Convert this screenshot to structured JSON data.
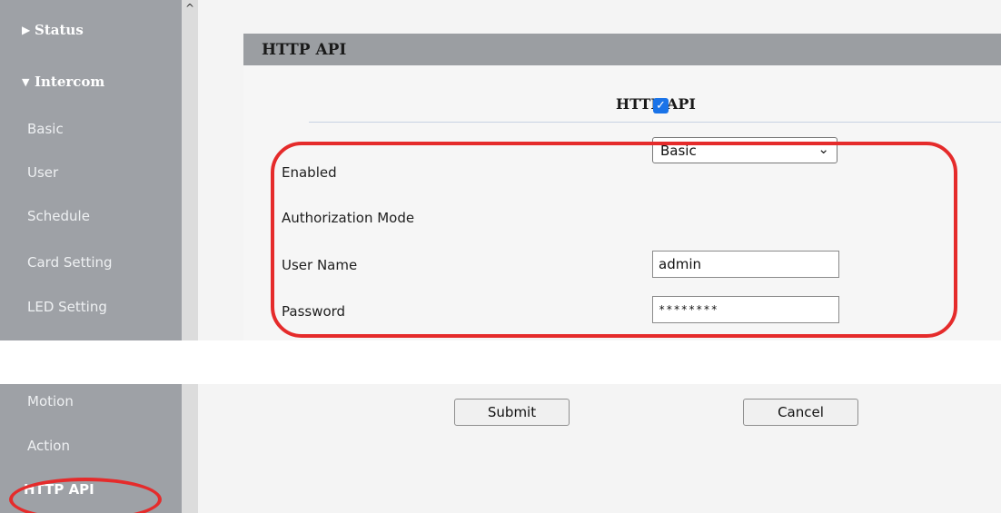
{
  "sidebar": {
    "groups": [
      {
        "label": "Status",
        "tri": "▶"
      },
      {
        "label": "Intercom",
        "tri": "▼"
      }
    ],
    "items": [
      {
        "label": "Basic"
      },
      {
        "label": "User"
      },
      {
        "label": "Schedule"
      },
      {
        "label": "Card Setting"
      },
      {
        "label": "LED Setting"
      },
      {
        "label": "Motion"
      },
      {
        "label": "Action"
      },
      {
        "label": "HTTP API"
      }
    ],
    "scroll_up": "^"
  },
  "page": {
    "title": "HTTP API",
    "section_heading": "HTTP API"
  },
  "form": {
    "enabled": {
      "label": "Enabled",
      "checked": true,
      "checkmark": "✓"
    },
    "auth_mode": {
      "label": "Authorization Mode",
      "value": "Basic",
      "chevron": "⌄"
    },
    "user_name": {
      "label": "User Name",
      "value": "admin"
    },
    "password": {
      "label": "Password",
      "value": "********"
    }
  },
  "buttons": {
    "submit": "Submit",
    "cancel": "Cancel"
  },
  "colors": {
    "highlight": "#e52b2b",
    "sidebar": "#9ea1a6",
    "checkbox": "#1a73e8"
  }
}
